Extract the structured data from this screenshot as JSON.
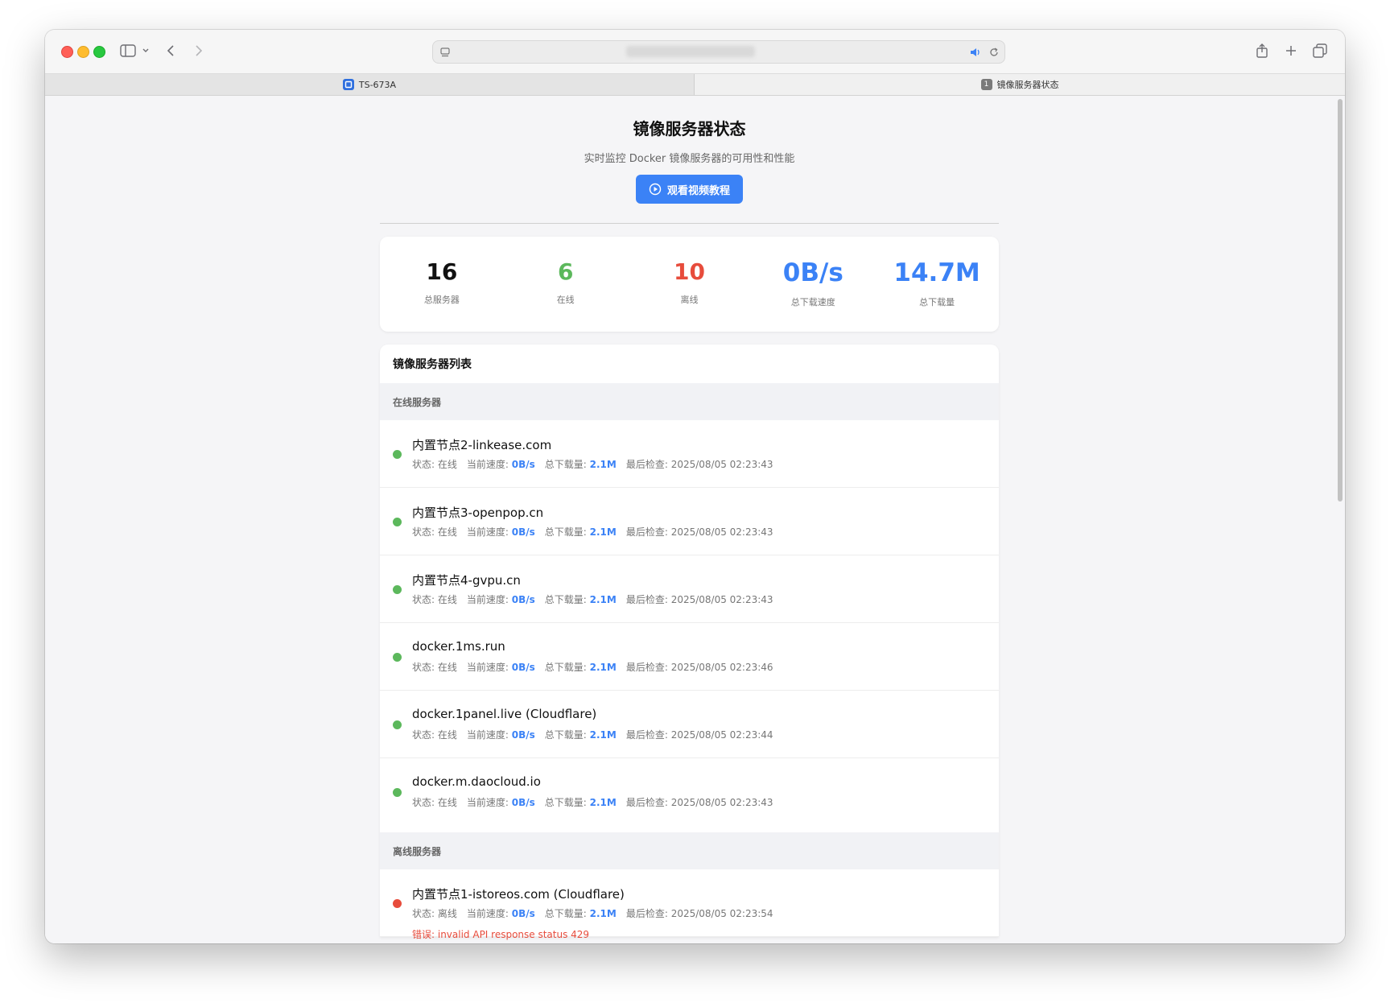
{
  "browser": {
    "tabs": [
      {
        "label": "TS-673A",
        "badge": ""
      },
      {
        "label": "镜像服务器状态",
        "badge": "1"
      }
    ]
  },
  "header": {
    "title": "镜像服务器状态",
    "subtitle": "实时监控 Docker 镜像服务器的可用性和性能",
    "video_button": "观看视频教程"
  },
  "stats": [
    {
      "value": "16",
      "label": "总服务器",
      "color": "#111111"
    },
    {
      "value": "6",
      "label": "在线",
      "color": "#5cb85c"
    },
    {
      "value": "10",
      "label": "离线",
      "color": "#e74c3c"
    },
    {
      "value": "0B/s",
      "label": "总下载速度",
      "color": "#3b82f6"
    },
    {
      "value": "14.7M",
      "label": "总下载量",
      "color": "#3b82f6"
    }
  ],
  "list": {
    "title": "镜像服务器列表",
    "online_header": "在线服务器",
    "offline_header": "离线服务器",
    "labels": {
      "status": "状态: ",
      "speed": "当前速度: ",
      "total": "总下载量: ",
      "last_check": "最后检查: ",
      "error": "错误: "
    },
    "online": [
      {
        "name": "内置节点2-linkease.com",
        "status": "在线",
        "speed": "0B/s",
        "total": "2.1M",
        "last_check": "2025/08/05 02:23:43"
      },
      {
        "name": "内置节点3-openpop.cn",
        "status": "在线",
        "speed": "0B/s",
        "total": "2.1M",
        "last_check": "2025/08/05 02:23:43"
      },
      {
        "name": "内置节点4-gvpu.cn",
        "status": "在线",
        "speed": "0B/s",
        "total": "2.1M",
        "last_check": "2025/08/05 02:23:43"
      },
      {
        "name": "docker.1ms.run",
        "status": "在线",
        "speed": "0B/s",
        "total": "2.1M",
        "last_check": "2025/08/05 02:23:46"
      },
      {
        "name": "docker.1panel.live (Cloudflare)",
        "status": "在线",
        "speed": "0B/s",
        "total": "2.1M",
        "last_check": "2025/08/05 02:23:44"
      },
      {
        "name": "docker.m.daocloud.io",
        "status": "在线",
        "speed": "0B/s",
        "total": "2.1M",
        "last_check": "2025/08/05 02:23:43"
      }
    ],
    "offline": [
      {
        "name": "内置节点1-istoreos.com (Cloudflare)",
        "status": "离线",
        "speed": "0B/s",
        "total": "2.1M",
        "last_check": "2025/08/05 02:23:54",
        "error": "invalid API response status 429"
      }
    ]
  },
  "colors": {
    "online_dot": "#5cb85c",
    "offline_dot": "#e74c3c",
    "accent": "#3b82f6"
  }
}
